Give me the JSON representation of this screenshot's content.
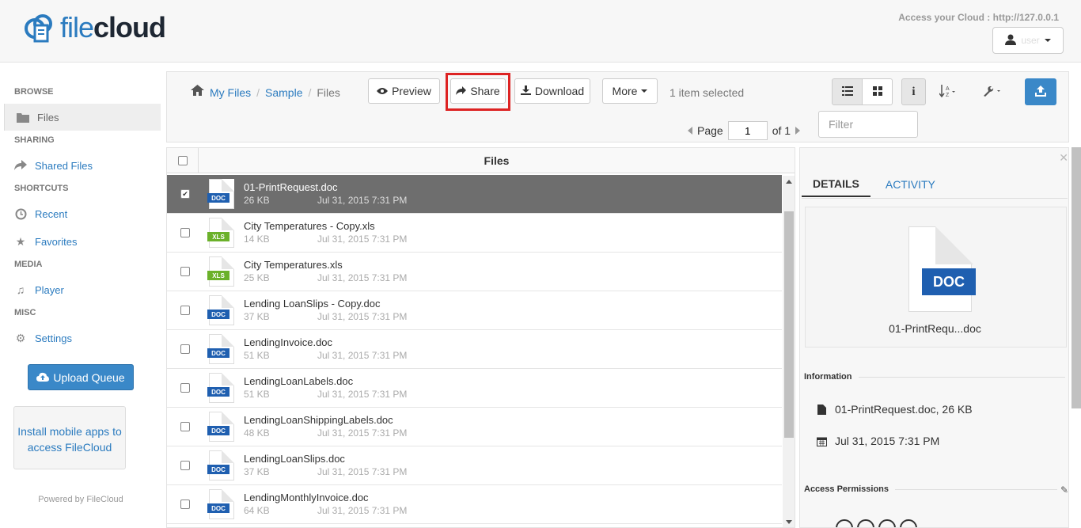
{
  "header": {
    "logo_text": "filecloud",
    "access_text": "Access your Cloud : http://127.0.0.1",
    "user_name": "user"
  },
  "sidebar": {
    "sections": [
      {
        "label": "BROWSE"
      },
      {
        "label": "SHARING"
      },
      {
        "label": "SHORTCUTS"
      },
      {
        "label": "MEDIA"
      },
      {
        "label": "MISC"
      }
    ],
    "items": [
      {
        "label": "Files",
        "icon": "folder-icon"
      },
      {
        "label": "Shared Files",
        "icon": "share-icon"
      },
      {
        "label": "Recent",
        "icon": "clock-icon"
      },
      {
        "label": "Favorites",
        "icon": "star-icon"
      },
      {
        "label": "Player",
        "icon": "music-icon"
      },
      {
        "label": "Settings",
        "icon": "gear-icon"
      }
    ],
    "upload_queue_label": "Upload Queue",
    "mobile_text": "Install mobile apps to access FileCloud",
    "powered_by": "Powered by FileCloud"
  },
  "toolbar": {
    "breadcrumb": [
      "My Files",
      "Sample",
      "Files"
    ],
    "preview_label": "Preview",
    "share_label": "Share",
    "download_label": "Download",
    "more_label": "More",
    "selected_text": "1 item selected",
    "page_label": "Page",
    "page_value": "1",
    "of_label": "of 1",
    "filter_placeholder": "Filter"
  },
  "list": {
    "header": "Files",
    "files": [
      {
        "name": "01-PrintRequest.doc",
        "size": "26 KB",
        "date": "Jul 31, 2015 7:31 PM",
        "type": "DOC",
        "selected": true
      },
      {
        "name": "City Temperatures - Copy.xls",
        "size": "14 KB",
        "date": "Jul 31, 2015 7:31 PM",
        "type": "XLS",
        "selected": false
      },
      {
        "name": "City Temperatures.xls",
        "size": "25 KB",
        "date": "Jul 31, 2015 7:31 PM",
        "type": "XLS",
        "selected": false
      },
      {
        "name": "Lending LoanSlips - Copy.doc",
        "size": "37 KB",
        "date": "Jul 31, 2015 7:31 PM",
        "type": "DOC",
        "selected": false
      },
      {
        "name": "LendingInvoice.doc",
        "size": "51 KB",
        "date": "Jul 31, 2015 7:31 PM",
        "type": "DOC",
        "selected": false
      },
      {
        "name": "LendingLoanLabels.doc",
        "size": "51 KB",
        "date": "Jul 31, 2015 7:31 PM",
        "type": "DOC",
        "selected": false
      },
      {
        "name": "LendingLoanShippingLabels.doc",
        "size": "48 KB",
        "date": "Jul 31, 2015 7:31 PM",
        "type": "DOC",
        "selected": false
      },
      {
        "name": "LendingLoanSlips.doc",
        "size": "37 KB",
        "date": "Jul 31, 2015 7:31 PM",
        "type": "DOC",
        "selected": false
      },
      {
        "name": "LendingMonthlyInvoice.doc",
        "size": "64 KB",
        "date": "Jul 31, 2015 7:31 PM",
        "type": "DOC",
        "selected": false
      }
    ]
  },
  "details": {
    "tab_details": "DETAILS",
    "tab_activity": "ACTIVITY",
    "preview_type": "DOC",
    "preview_name": "01-PrintRequ...doc",
    "information_title": "Information",
    "info_file": "01-PrintRequest.doc, 26 KB",
    "info_date": "Jul 31, 2015 7:31 PM",
    "permissions_title": "Access Permissions"
  },
  "colors": {
    "accent": "#2b7bbf",
    "selected_row": "#6e6e6e",
    "doc_tag": "#1f5fb0",
    "xls_tag": "#6bb12a",
    "highlight": "#dd2222"
  }
}
